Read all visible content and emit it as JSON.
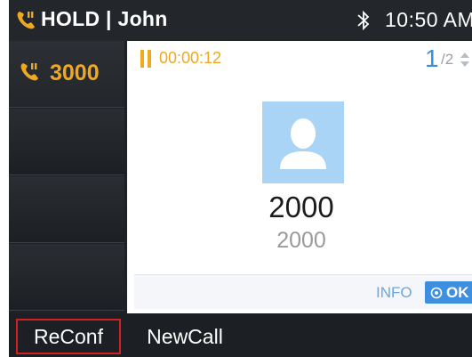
{
  "status_bar": {
    "state_text": "HOLD | John",
    "clock": "10:50 AM",
    "icons": {
      "call_status": "phone-hold-icon",
      "bluetooth": "bluetooth-icon"
    }
  },
  "lines": [
    {
      "label": "3000",
      "icon": "phone-hold-icon",
      "active": true
    },
    {
      "label": ""
    },
    {
      "label": ""
    },
    {
      "label": ""
    }
  ],
  "call": {
    "timer": "00:00:12",
    "page_current": "1",
    "page_total": "/2",
    "contact_name": "2000",
    "contact_number": "2000",
    "info_label": "INFO",
    "ok_label": "OK"
  },
  "softkeys": {
    "reconf": "ReConf",
    "newcall": "NewCall"
  },
  "colors": {
    "accent_orange": "#f0a81e",
    "accent_blue": "#3f8fe0",
    "avatar_bg": "#a9d4f5",
    "highlight_red": "#d21f1f"
  }
}
